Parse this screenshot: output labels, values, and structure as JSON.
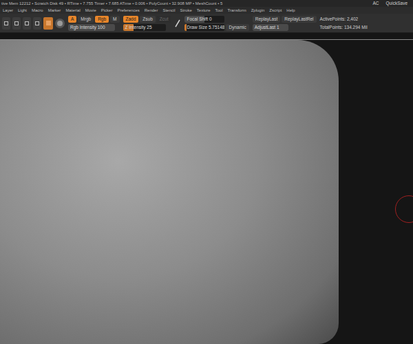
{
  "status_bar": {
    "text": "tive Mem 12212 • Scratch Disk 49 • RTime • 7.755 Timer • 7.685 ATime • 0.006 • PolyCount • 32.908 MP • MeshCount • 5",
    "right": [
      "AC",
      "QuickSave"
    ]
  },
  "menu": [
    "Layer",
    "Light",
    "Macro",
    "Marker",
    "Material",
    "Movie",
    "Picker",
    "Preferences",
    "Render",
    "Stencil",
    "Stroke",
    "Texture",
    "Tool",
    "Transform",
    "Zplugin",
    "Zscript",
    "Help"
  ],
  "toolbar": {
    "tools": [
      {
        "selected": false
      },
      {
        "selected": false
      },
      {
        "selected": false
      },
      {
        "selected": false
      },
      {
        "selected": true
      }
    ],
    "color_modes": [
      {
        "label": "A",
        "selected": true
      },
      {
        "label": "Mrgb",
        "selected": false
      },
      {
        "label": "Rgb",
        "selected": true
      },
      {
        "label": "M",
        "selected": false
      }
    ],
    "depth_modes": [
      {
        "label": "Zadd",
        "selected": true,
        "disabled": false
      },
      {
        "label": "Zsub",
        "selected": false,
        "disabled": false
      },
      {
        "label": "Zcut",
        "selected": false,
        "disabled": true
      }
    ],
    "rgb_intensity": {
      "label": "Rgb Intensity",
      "value": "100",
      "level": 1,
      "active": false
    },
    "z_intensity": {
      "label": "Z Intensity",
      "value": "25",
      "level": 0.25,
      "active": true
    },
    "focal_shift": {
      "label": "Focal Shift",
      "value": "0",
      "level": 0.5,
      "active": false
    },
    "draw_size": {
      "label": "Draw Size",
      "value": "5.75148",
      "level": 0.05,
      "active": true
    },
    "dynamic": {
      "label": "Dynamic",
      "selected": false
    },
    "replay_buttons": [
      "ReplayLast",
      "ReplayLastRel"
    ],
    "adjust_last": {
      "label": "AdjustLast",
      "value": "1",
      "level": 1,
      "active": false
    },
    "active_points": "ActivePoints: 2,402",
    "total_points": "TotalPoints: 134.294 Mil"
  }
}
